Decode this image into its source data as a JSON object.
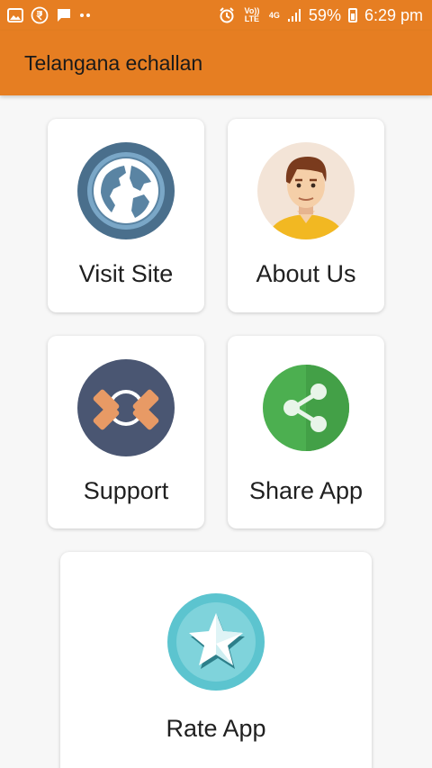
{
  "status_bar": {
    "left_icons": [
      "gallery-icon",
      "rupee-icon",
      "message-icon",
      "more-dots-icon"
    ],
    "volte": "Vo)) LTE",
    "network": "4G",
    "battery": "59%",
    "time": "6:29 pm",
    "icons": [
      "alarm-icon",
      "signal-icon",
      "battery-icon"
    ]
  },
  "app_bar": {
    "title": "Telangana echallan"
  },
  "cards": {
    "visit_site": {
      "label": "Visit Site",
      "icon": "globe-icon"
    },
    "about_us": {
      "label": "About Us",
      "icon": "person-avatar-icon"
    },
    "support": {
      "label": "Support",
      "icon": "lifebuoy-icon"
    },
    "share_app": {
      "label": "Share App",
      "icon": "share-icon"
    },
    "rate_app": {
      "label": "Rate App",
      "icon": "star-icon"
    }
  },
  "colors": {
    "accent": "#e67e22",
    "background": "#f7f7f7",
    "card": "#ffffff",
    "share_green": "#4caf50",
    "globe_blue": "#4a6f8c",
    "star_teal": "#5cc4cf"
  }
}
